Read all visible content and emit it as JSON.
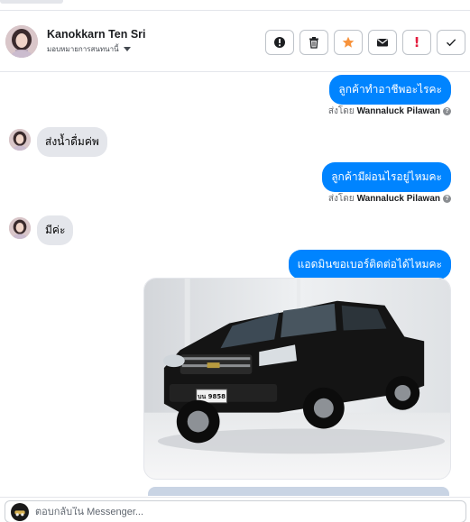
{
  "header": {
    "name": "Kanokkarn Ten Sri",
    "assign_label": "มอบหมายการสนทนานี้"
  },
  "actions": [
    {
      "id": "spam",
      "icon": "alert-circle-icon"
    },
    {
      "id": "delete",
      "icon": "trash-icon"
    },
    {
      "id": "follow-up",
      "icon": "star-icon"
    },
    {
      "id": "mark-unread",
      "icon": "envelope-icon"
    },
    {
      "id": "priority",
      "icon": "exclamation-icon"
    },
    {
      "id": "done",
      "icon": "check-icon"
    }
  ],
  "messages": [
    {
      "direction": "out",
      "text": "ลูกค้าทำอาชีพอะไรคะ",
      "sent_by_prefix": "ส่งโดย",
      "sent_by_name": "Wannaluck Pilawan"
    },
    {
      "direction": "in",
      "text": "ส่งน้ำดื่มค่พ"
    },
    {
      "direction": "out",
      "text": "ลูกค้ามีผ่อนไรอยู่ไหมคะ",
      "sent_by_prefix": "ส่งโดย",
      "sent_by_name": "Wannaluck Pilawan"
    },
    {
      "direction": "in",
      "text": "มีค่ะ"
    },
    {
      "direction": "out",
      "text": "แอดมินขอเบอร์ติดต่อได้ไหมคะ"
    }
  ],
  "photo": {
    "subject": "black pickup truck",
    "plate_text": "บน 9858"
  },
  "composer": {
    "placeholder": "ตอบกลับใน Messenger..."
  },
  "colors": {
    "outgoing_bubble": "#0084ff",
    "incoming_bubble": "#e4e6eb",
    "follow_up_star": "#f7923b",
    "priority_mark": "#e41e3f"
  }
}
